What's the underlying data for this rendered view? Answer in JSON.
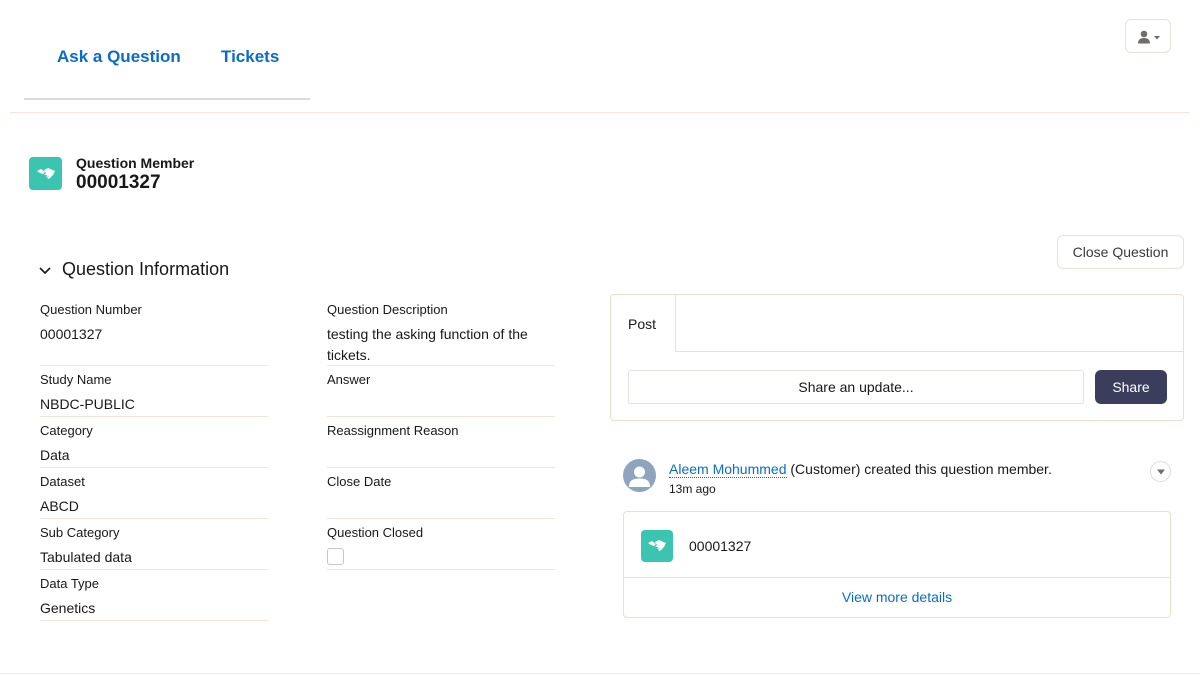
{
  "nav": {
    "ask_label": "Ask a Question",
    "tickets_label": "Tickets"
  },
  "record": {
    "type_label": "Question Member",
    "number": "00001327"
  },
  "section": {
    "title": "Question Information"
  },
  "fields_left": [
    {
      "label": "Question Number",
      "value": "00001327"
    },
    {
      "label": "Study Name",
      "value": "NBDC-PUBLIC"
    },
    {
      "label": "Category",
      "value": "Data"
    },
    {
      "label": "Dataset",
      "value": "ABCD"
    },
    {
      "label": "Sub Category",
      "value": "Tabulated data"
    },
    {
      "label": "Data Type",
      "value": "Genetics"
    }
  ],
  "fields_right": [
    {
      "label": "Question Description",
      "value": "testing the asking function of the tickets."
    },
    {
      "label": "Answer",
      "value": ""
    },
    {
      "label": "Reassignment Reason",
      "value": ""
    },
    {
      "label": "Close Date",
      "value": ""
    },
    {
      "label": "Question Closed",
      "checked": false
    }
  ],
  "actions": {
    "close_question_label": "Close Question"
  },
  "publisher": {
    "tab_label": "Post",
    "placeholder": "Share an update...",
    "share_label": "Share"
  },
  "feed": {
    "user_name": "Aleem Mohummed",
    "action_text": " (Customer) created this question member.",
    "time_ago": "13m ago",
    "record_number": "00001327",
    "view_more_label": "View more details"
  },
  "colors": {
    "link": "#0b6cc7",
    "record_icon": "#3bc5b0",
    "share_button": "#3b3d5c",
    "avatar": "#8fa4bf"
  }
}
